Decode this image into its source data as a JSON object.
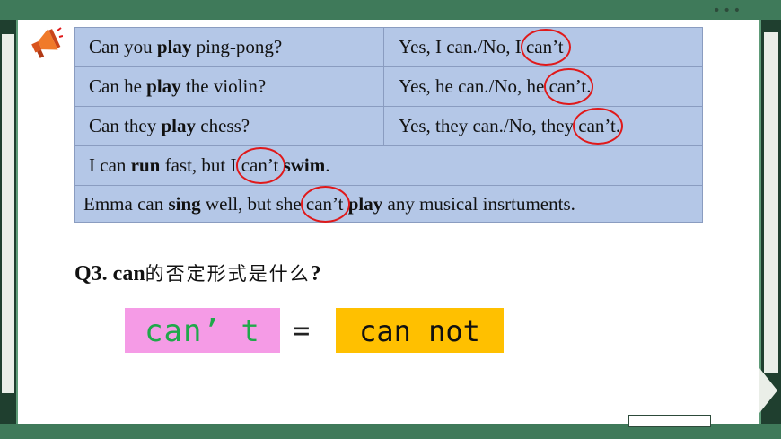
{
  "colors": {
    "frame": "#5e9b78",
    "table_fill": "#b4c7e7",
    "circle": "#e0191a",
    "pink_box": "#f59be6",
    "pink_text": "#1fa84a",
    "orange_box": "#ffc000"
  },
  "icons": {
    "speaker": "megaphone-icon",
    "dots": "•••"
  },
  "table": {
    "row1": {
      "q_pre": "Can you ",
      "q_bold": "play",
      "q_post": " ping-pong?",
      "a_pre": "Yes, I can./No, I ",
      "a_circle": "can’t",
      "a_post": ""
    },
    "row2": {
      "q_pre": "Can he ",
      "q_bold": "play",
      "q_post": " the violin?",
      "a_pre": "Yes, he can./No, he ",
      "a_circle": "can’t",
      "a_post": "."
    },
    "row3": {
      "q_pre": "Can  they ",
      "q_bold": "play",
      "q_post": " chess?",
      "a_pre": "Yes, they can./No, they ",
      "a_circle": "can’t",
      "a_post": "."
    },
    "row4": {
      "pre": "I can ",
      "bold1": "run",
      "mid": " fast, but I ",
      "circle": "can’t",
      "bold2": " swim",
      "post": "."
    },
    "row5": {
      "pre": "Emma can ",
      "bold1": "sing",
      "mid": " well, but she ",
      "circle": "can’t",
      "bold2": " play",
      "post": " any musical insrtuments."
    }
  },
  "question": {
    "label": "Q3. can",
    "cn": "的否定形式是什么",
    "end": "?"
  },
  "equation": {
    "left": "can’ t",
    "equals": "=",
    "right": "can not"
  }
}
